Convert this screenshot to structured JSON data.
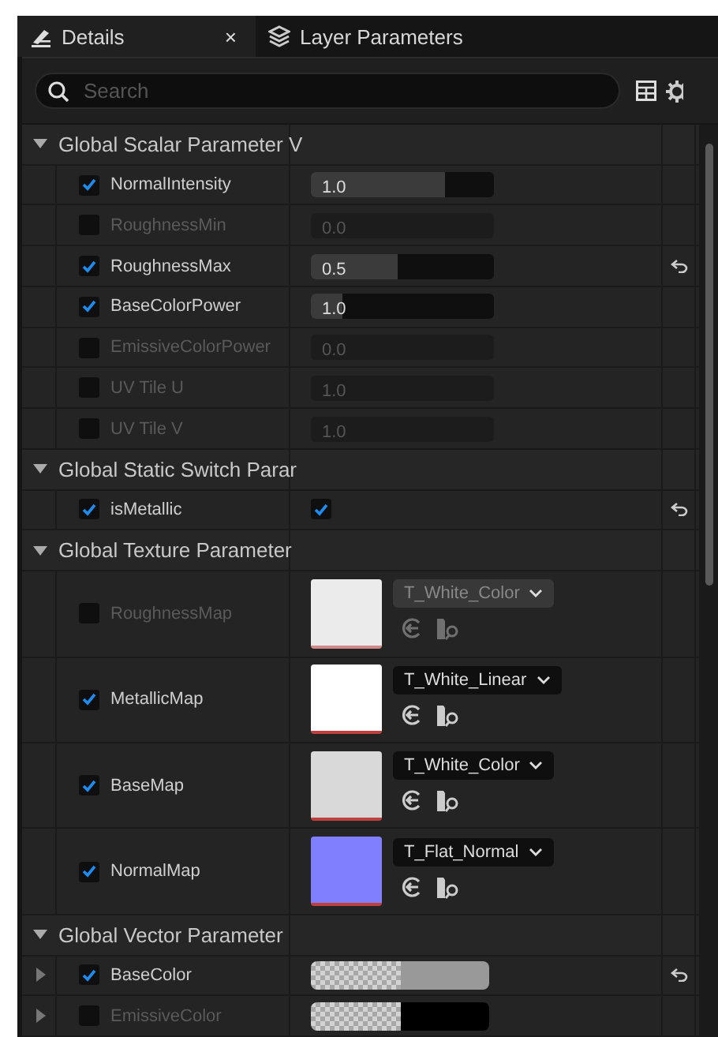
{
  "tabs": [
    {
      "label": "Details",
      "selected": true,
      "close": "×"
    },
    {
      "label": "Layer Parameters",
      "selected": false
    }
  ],
  "search": {
    "placeholder": "Search"
  },
  "categories": [
    {
      "title": "Global Scalar Parameter V",
      "expanded": true,
      "params": [
        {
          "kind": "scalar",
          "name": "NormalIntensity",
          "checked": true,
          "value": "1.0",
          "level": 0.73,
          "reset": false
        },
        {
          "kind": "scalar",
          "name": "RoughnessMin",
          "checked": false,
          "value": "0.0",
          "reset": false
        },
        {
          "kind": "scalar",
          "name": "RoughnessMax",
          "checked": true,
          "value": "0.5",
          "level": 0.47,
          "reset": true
        },
        {
          "kind": "scalar",
          "name": "BaseColorPower",
          "checked": true,
          "value": "1.0",
          "level": 0.17,
          "reset": false
        },
        {
          "kind": "scalar",
          "name": "EmissiveColorPower",
          "checked": false,
          "value": "0.0",
          "reset": false
        },
        {
          "kind": "scalar",
          "name": "UV Tile U",
          "checked": false,
          "value": "1.0",
          "reset": false
        },
        {
          "kind": "scalar",
          "name": "UV Tile V",
          "checked": false,
          "value": "1.0",
          "reset": false
        }
      ]
    },
    {
      "title": "Global Static Switch Parar",
      "expanded": true,
      "params": [
        {
          "kind": "switch",
          "name": "isMetallic",
          "checked": true,
          "on": true,
          "reset": true
        }
      ]
    },
    {
      "title": "Global Texture Parameter",
      "expanded": true,
      "params": [
        {
          "kind": "texture",
          "name": "RoughnessMap",
          "checked": false,
          "asset": "T_White_Color",
          "color": "#ebebeb",
          "reset": false
        },
        {
          "kind": "texture",
          "name": "MetallicMap",
          "checked": true,
          "asset": "T_White_Linear",
          "color": "#ffffff",
          "reset": false
        },
        {
          "kind": "texture",
          "name": "BaseMap",
          "checked": true,
          "asset": "T_White_Color",
          "color": "#d9d9d9",
          "reset": false
        },
        {
          "kind": "texture",
          "name": "NormalMap",
          "checked": true,
          "asset": "T_Flat_Normal",
          "color": "#8080ff",
          "reset": false
        }
      ]
    },
    {
      "title": "Global Vector Parameter",
      "expanded": true,
      "params": [
        {
          "kind": "vector",
          "name": "BaseColor",
          "checked": true,
          "expanded": false,
          "color": "#999999",
          "reset": true
        },
        {
          "kind": "vector",
          "name": "EmissiveColor",
          "checked": false,
          "expanded": false,
          "color": "#000000",
          "reset": false
        }
      ]
    }
  ]
}
